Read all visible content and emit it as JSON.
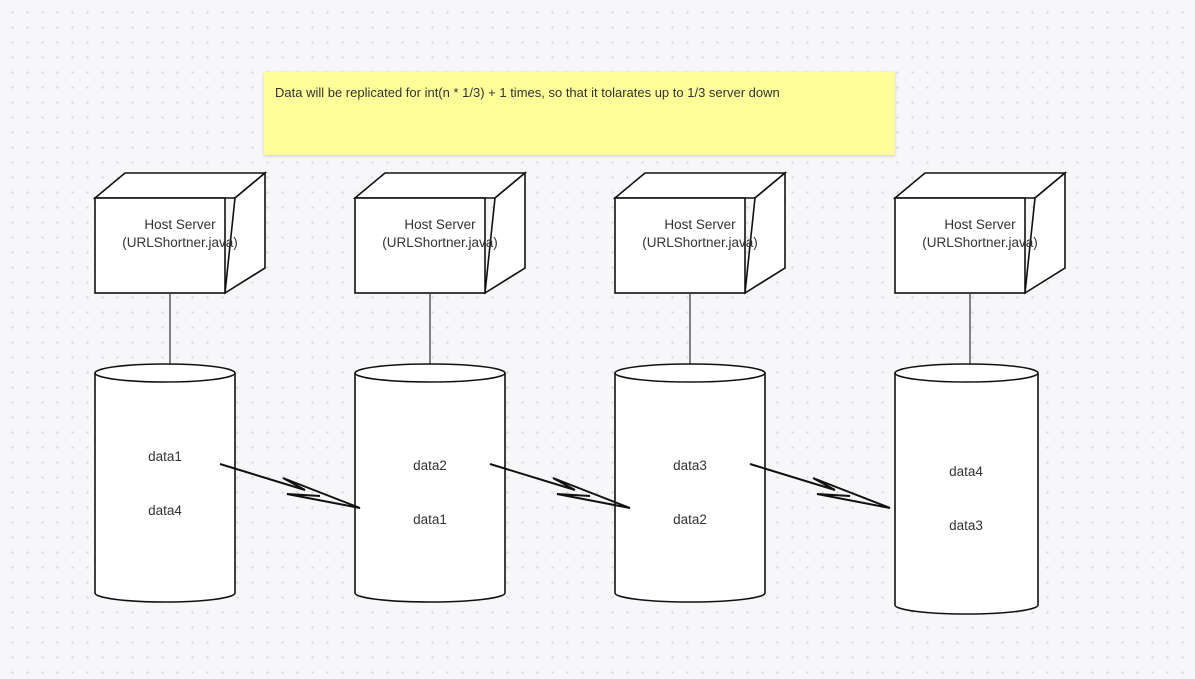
{
  "note": {
    "text": "Data will be replicated for int(n * 1/3) + 1 times, so that it tolarates up to 1/3 server down",
    "color": "#ffff99"
  },
  "nodes": [
    {
      "server_line1": "Host Server",
      "server_line2": "(URLShortner.java)",
      "db_items": [
        "data1",
        "data4"
      ]
    },
    {
      "server_line1": "Host Server",
      "server_line2": "(URLShortner.java)",
      "db_items": [
        "data2",
        "data1"
      ]
    },
    {
      "server_line1": "Host Server",
      "server_line2": "(URLShortner.java)",
      "db_items": [
        "data3",
        "data2"
      ]
    },
    {
      "server_line1": "Host Server",
      "server_line2": "(URLShortner.java)",
      "db_items": [
        "data4",
        "data3"
      ]
    }
  ]
}
